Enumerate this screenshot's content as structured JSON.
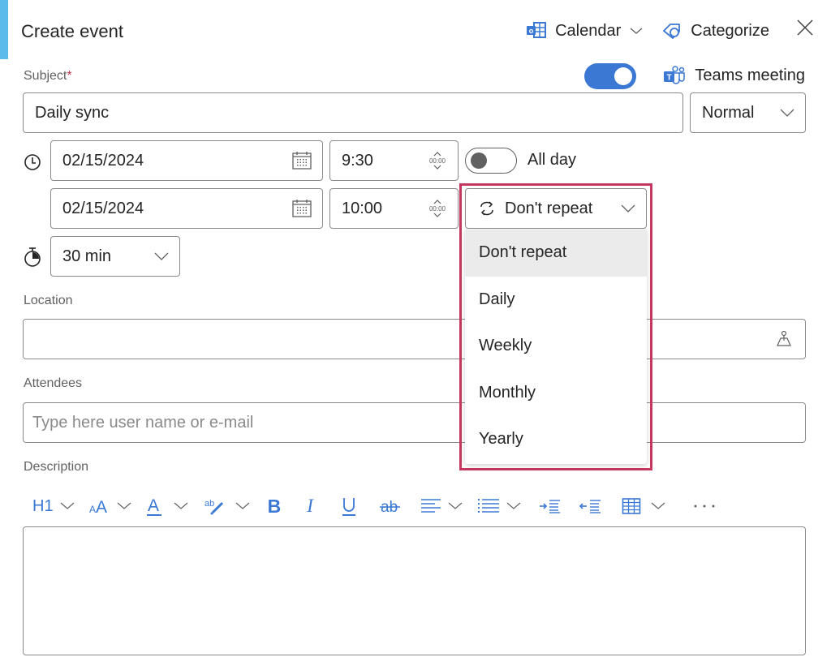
{
  "header": {
    "title": "Create event",
    "calendar_label": "Calendar",
    "categorize_label": "Categorize",
    "icons": [
      "outlook-calendar-icon",
      "tag-icon",
      "close-icon"
    ]
  },
  "subject": {
    "label": "Subject",
    "required_mark": "*",
    "value": "Daily sync"
  },
  "teams": {
    "toggle_on": true,
    "label": "Teams meeting"
  },
  "importance": {
    "selected": "Normal"
  },
  "start": {
    "date": "02/15/2024",
    "time": "9:30"
  },
  "end": {
    "date": "02/15/2024",
    "time": "10:00"
  },
  "all_day": {
    "toggle_on": false,
    "label": "All day"
  },
  "duration": {
    "selected": "30 min"
  },
  "repeat": {
    "selected": "Don't repeat",
    "options": [
      "Don't repeat",
      "Daily",
      "Weekly",
      "Monthly",
      "Yearly"
    ]
  },
  "location": {
    "label": "Location",
    "value": ""
  },
  "attendees": {
    "label": "Attendees",
    "placeholder": "Type here user name or e-mail"
  },
  "description": {
    "label": "Description",
    "value": ""
  },
  "toolbar": {
    "heading_label": "H1",
    "items": [
      "heading",
      "font-size",
      "font-color",
      "highlight",
      "bold",
      "italic",
      "underline",
      "strikethrough",
      "align",
      "bullets",
      "indent",
      "outdent",
      "table",
      "more"
    ]
  },
  "colors": {
    "accent_blue": "#3a78d4",
    "highlight_border": "#c4375e",
    "sidebar_accent": "#5bbcec",
    "required_red": "#c4314b"
  }
}
